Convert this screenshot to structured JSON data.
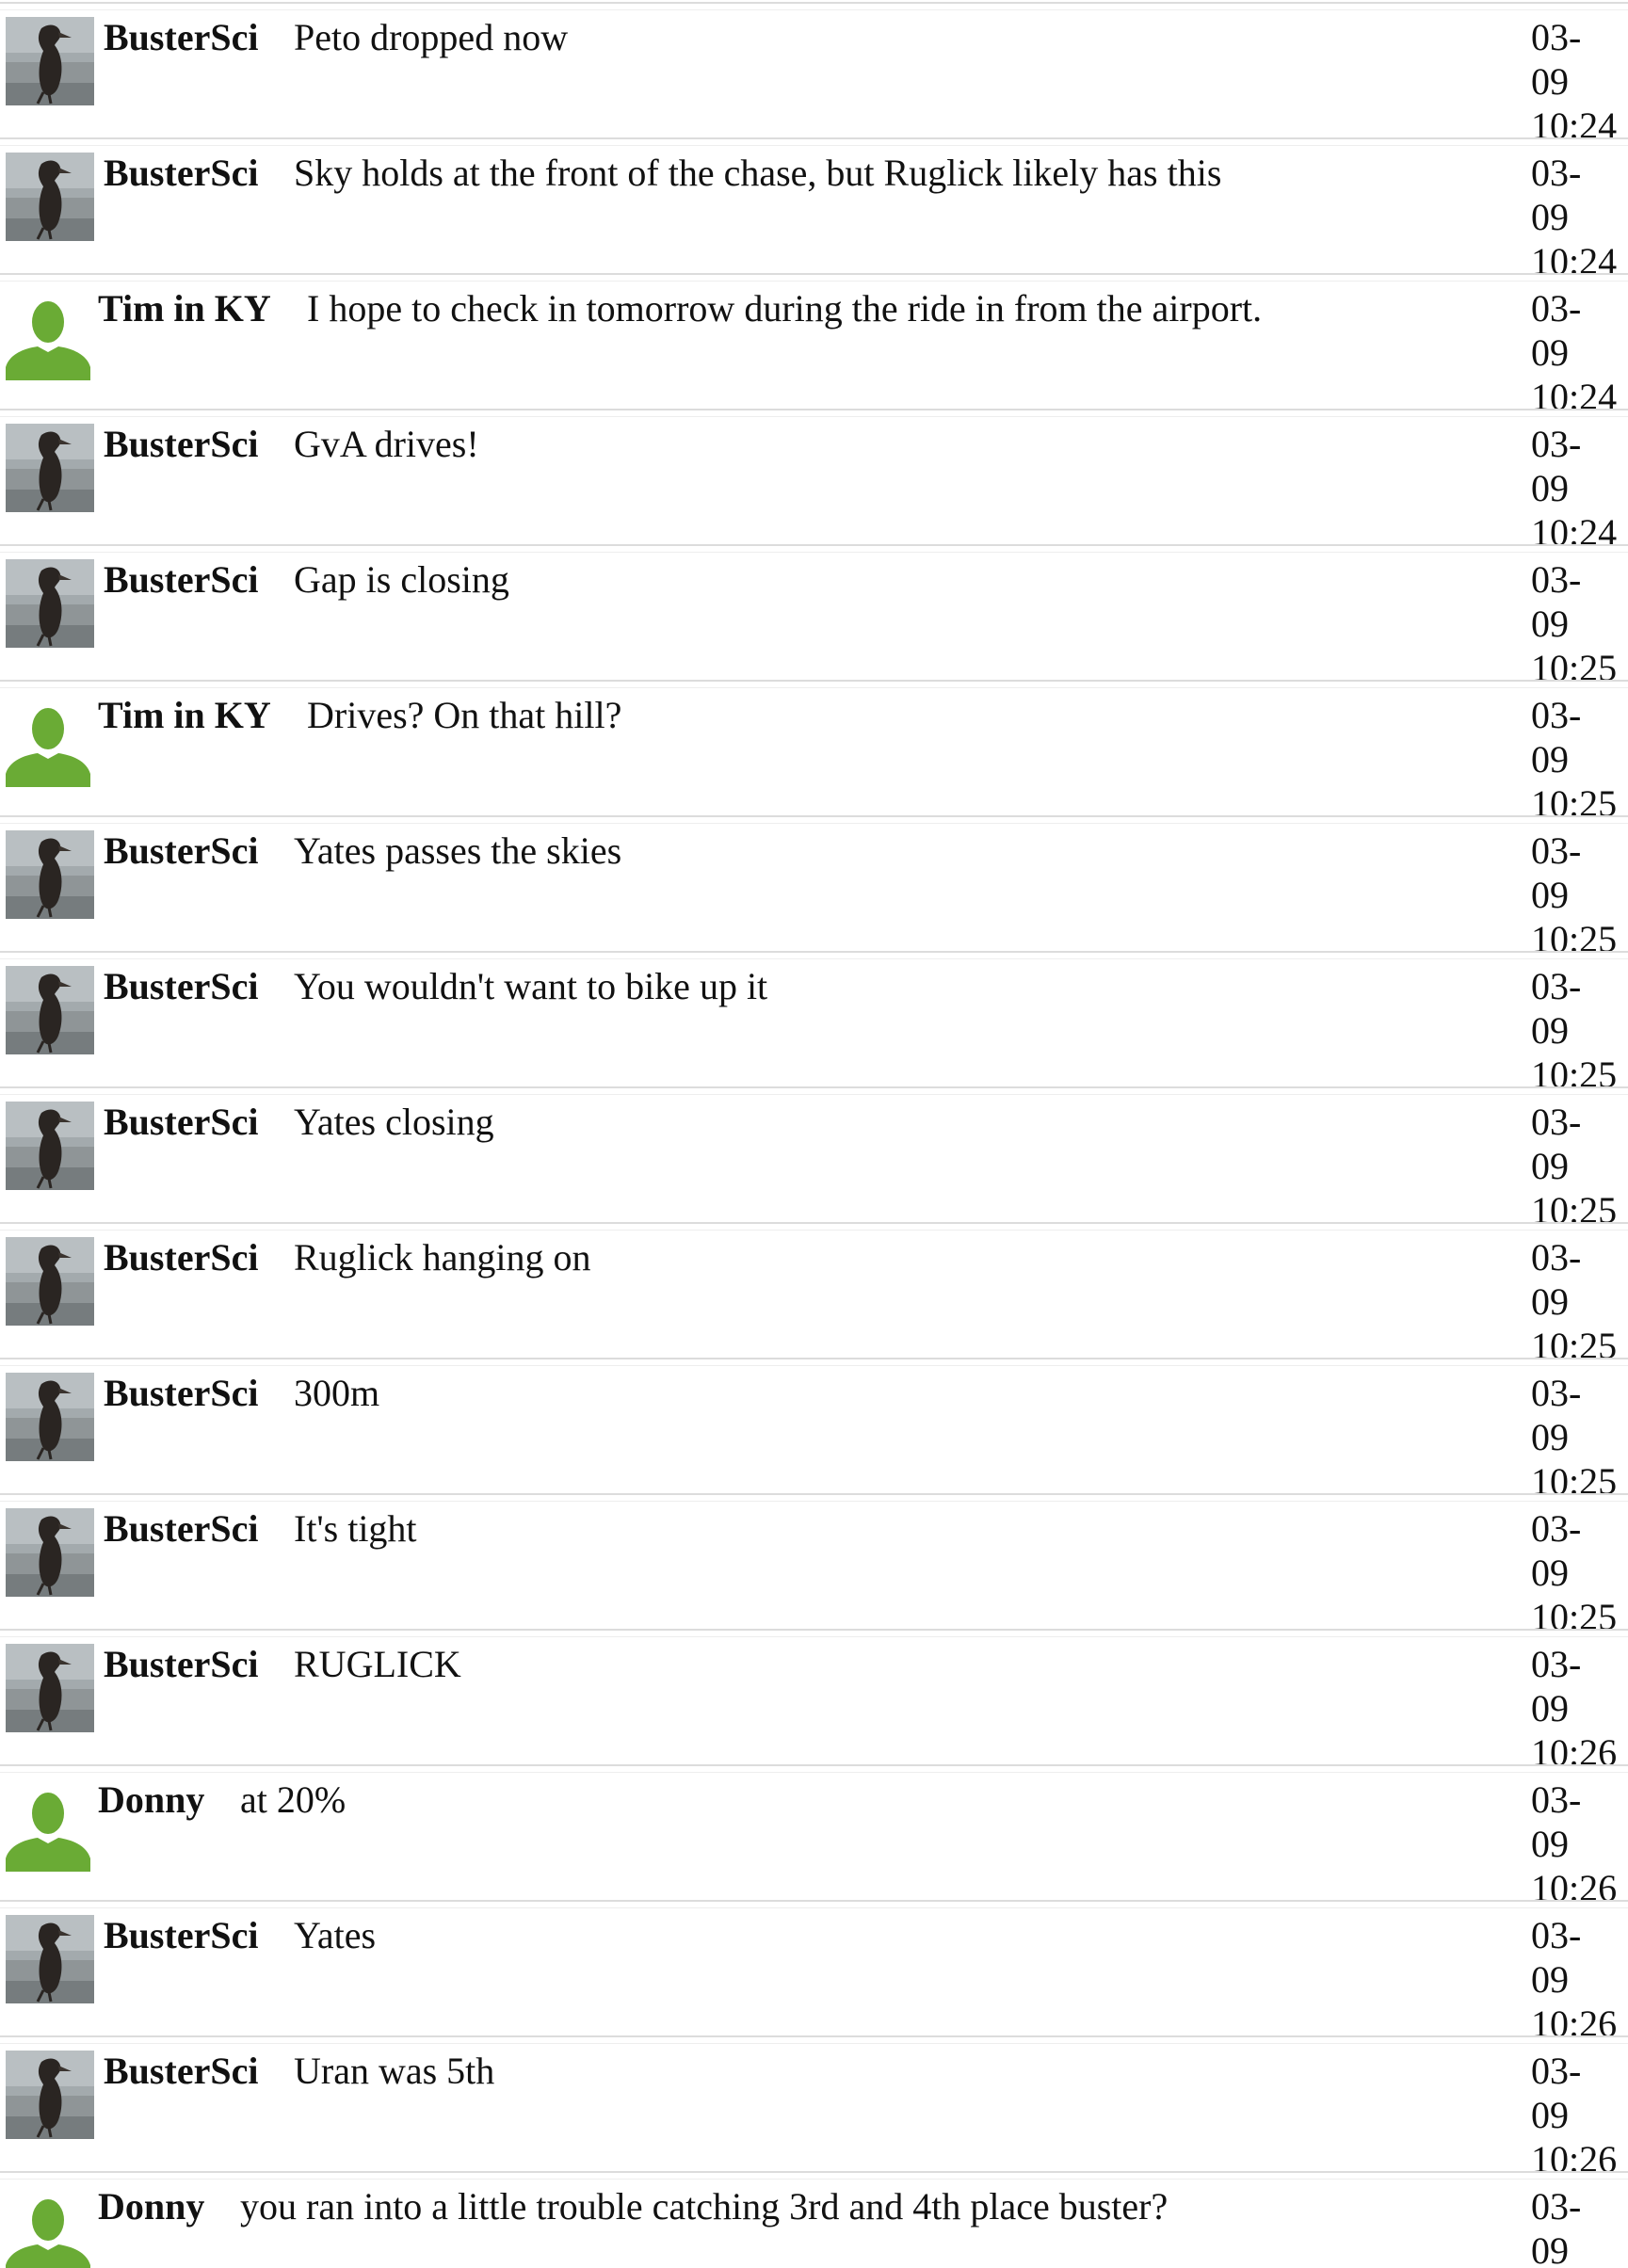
{
  "colors": {
    "divider": "#dcdcdc",
    "avatar_person": "#6aab35"
  },
  "messages": [
    {
      "user": "BusterSci",
      "avatar": "penguin-icon",
      "text": "Peto dropped now",
      "date": "03-",
      "day": "09",
      "time": "10:24"
    },
    {
      "user": "BusterSci",
      "avatar": "penguin-icon",
      "text": "Sky holds at the front of the chase, but Ruglick likely has this",
      "date": "03-",
      "day": "09",
      "time": "10:24"
    },
    {
      "user": "Tim in KY",
      "avatar": "person-icon",
      "text": "I hope to check in tomorrow during the ride in from the airport.",
      "date": "03-",
      "day": "09",
      "time": "10:24"
    },
    {
      "user": "BusterSci",
      "avatar": "penguin-icon",
      "text": "GvA drives!",
      "date": "03-",
      "day": "09",
      "time": "10:24"
    },
    {
      "user": "BusterSci",
      "avatar": "penguin-icon",
      "text": "Gap is closing",
      "date": "03-",
      "day": "09",
      "time": "10:25"
    },
    {
      "user": "Tim in KY",
      "avatar": "person-icon",
      "text": "Drives? On that hill?",
      "date": "03-",
      "day": "09",
      "time": "10:25"
    },
    {
      "user": "BusterSci",
      "avatar": "penguin-icon",
      "text": "Yates passes the skies",
      "date": "03-",
      "day": "09",
      "time": "10:25"
    },
    {
      "user": "BusterSci",
      "avatar": "penguin-icon",
      "text": "You wouldn't want to bike up it",
      "date": "03-",
      "day": "09",
      "time": "10:25"
    },
    {
      "user": "BusterSci",
      "avatar": "penguin-icon",
      "text": "Yates closing",
      "date": "03-",
      "day": "09",
      "time": "10:25"
    },
    {
      "user": "BusterSci",
      "avatar": "penguin-icon",
      "text": "Ruglick hanging on",
      "date": "03-",
      "day": "09",
      "time": "10:25"
    },
    {
      "user": "BusterSci",
      "avatar": "penguin-icon",
      "text": "300m",
      "date": "03-",
      "day": "09",
      "time": "10:25"
    },
    {
      "user": "BusterSci",
      "avatar": "penguin-icon",
      "text": "It's tight",
      "date": "03-",
      "day": "09",
      "time": "10:25"
    },
    {
      "user": "BusterSci",
      "avatar": "penguin-icon",
      "text": "RUGLICK",
      "date": "03-",
      "day": "09",
      "time": "10:26"
    },
    {
      "user": "Donny",
      "avatar": "person-icon",
      "text": "at 20%",
      "date": "03-",
      "day": "09",
      "time": "10:26"
    },
    {
      "user": "BusterSci",
      "avatar": "penguin-icon",
      "text": "Yates",
      "date": "03-",
      "day": "09",
      "time": "10:26"
    },
    {
      "user": "BusterSci",
      "avatar": "penguin-icon",
      "text": "Uran was 5th",
      "date": "03-",
      "day": "09",
      "time": "10:26"
    },
    {
      "user": "Donny",
      "avatar": "person-icon",
      "text": "you ran into a little trouble catching 3rd and 4th place buster?",
      "date": "03-",
      "day": "09",
      "time": ""
    }
  ]
}
